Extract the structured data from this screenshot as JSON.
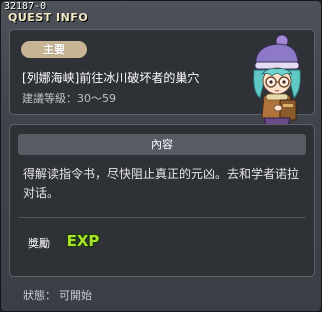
{
  "window": {
    "quest_id": "32187-0",
    "title": "QUEST INFO"
  },
  "summary": {
    "category_badge": "主要",
    "quest_name": "[列娜海峡]前往冰川破坏者的巢穴",
    "recommended_level_label": "建議等級：",
    "recommended_level_value": "30～59"
  },
  "npc": {
    "icon": "npc-scholar-girl-icon"
  },
  "content": {
    "header": "內容",
    "description": "得解读指令书，尽快阻止真正的元凶。去和学者诺拉对话。"
  },
  "reward": {
    "label": "獎勵",
    "exp_icon_text": "EXP"
  },
  "status": {
    "label": "狀態：",
    "value": "可開始"
  },
  "colors": {
    "window_bg": "#3f434a",
    "panel_bg": "#2e3136",
    "badge_bg": "#c7b494",
    "title_text": "#f2e7c3",
    "exp_green": "#a6e22e"
  }
}
